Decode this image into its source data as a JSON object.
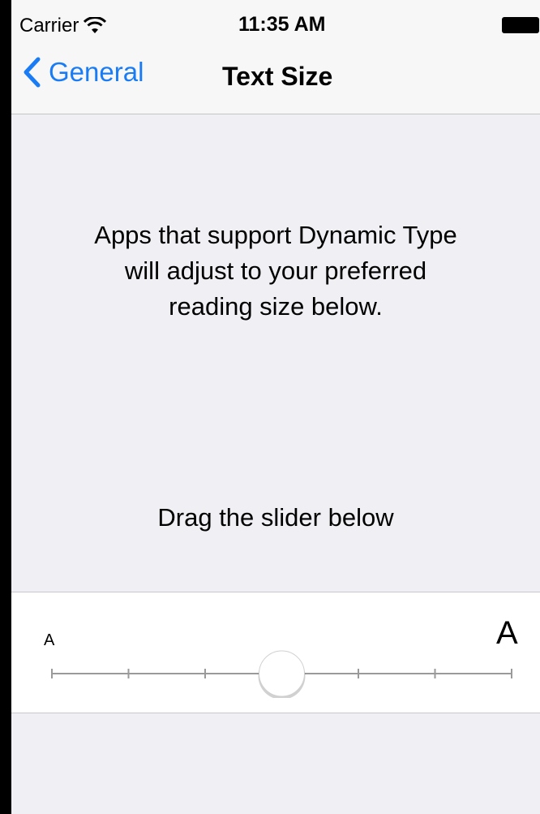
{
  "status_bar": {
    "carrier": "Carrier",
    "time": "11:35 AM",
    "wifi_icon": "wifi-icon",
    "battery_icon": "battery-icon"
  },
  "nav": {
    "back_label": "General",
    "back_icon": "chevron-left-icon",
    "title": "Text Size",
    "accent_color": "#1a7cf5"
  },
  "content": {
    "intro": "Apps that support Dynamic Type\nwill adjust to your preferred\nreading size below.",
    "instruction": "Drag the slider below"
  },
  "slider": {
    "min_label": "A",
    "max_label": "A",
    "steps": 7,
    "selected_index": 3
  }
}
